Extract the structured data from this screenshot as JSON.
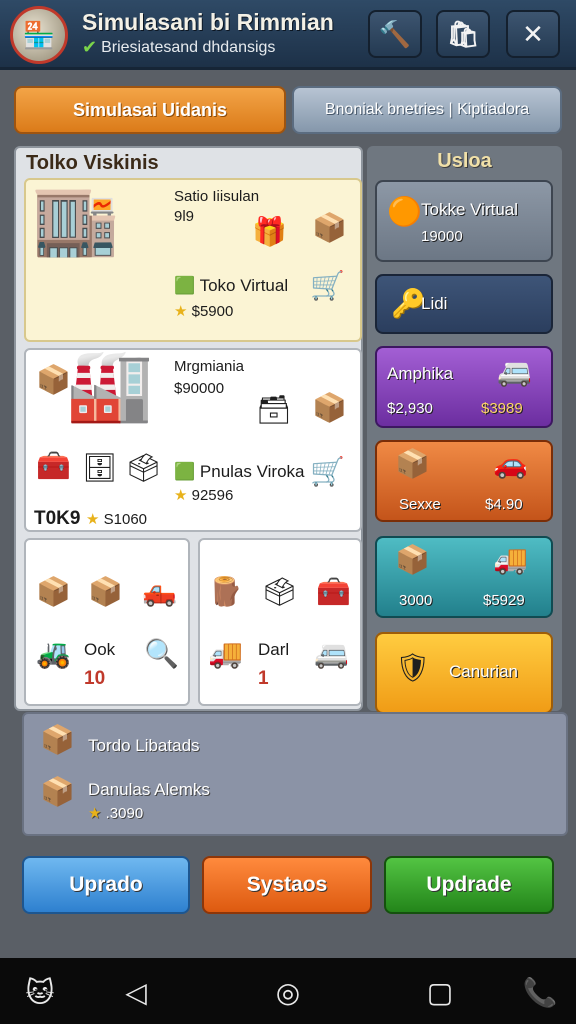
{
  "header": {
    "logo_icon": "shop-logo-icon",
    "title": "Simulasani bi Rimmian",
    "subtitle": "Briesiatesand dhdansigs"
  },
  "tabs": [
    {
      "label": "Simulasai Uidanis",
      "active": true
    },
    {
      "label": "Bnoniak bnetries | Kiptiadora",
      "active": false
    }
  ],
  "left_panel": {
    "heading": "Tolko Viskinis",
    "card1": {
      "line1": "Satio Iiisulan",
      "line2": "9l9",
      "name": "Toko Virtual",
      "price": "$5900"
    },
    "card2": {
      "line1": "Mrgmiania",
      "line2": "$90000",
      "name": "Pnulas Viroka",
      "price": "92596",
      "footer_label": "T0K9",
      "footer_price": "S1060"
    },
    "card3": {
      "label": "Ook",
      "value": "10"
    },
    "card4": {
      "label": "Darl",
      "value": "1"
    }
  },
  "right_panel": {
    "heading": "Usloa",
    "buttons": [
      {
        "label": "Tokke Virtual",
        "sub": "19000"
      },
      {
        "label": "Lidi"
      },
      {
        "label": "Amphika",
        "price1": "$2,930",
        "price2": "$3989"
      },
      {
        "label": "Sexxe",
        "price2": "$4.90"
      },
      {
        "label": "3000",
        "price2": "$5929"
      },
      {
        "label": "Canurian"
      }
    ]
  },
  "bottom_panel": {
    "row1": "Tordo Libatads",
    "row2": "Danulas Alemks",
    "row2_price": ".3090"
  },
  "actions": {
    "btn1": "Uprado",
    "btn2": "Systaos",
    "btn3": "Updrade"
  },
  "colors": {
    "header_bg": "#2f4a66",
    "tab_active": "#e8902e",
    "action_blue": "#2e80cf",
    "action_orange": "#dd5a10",
    "action_green": "#23851a"
  }
}
